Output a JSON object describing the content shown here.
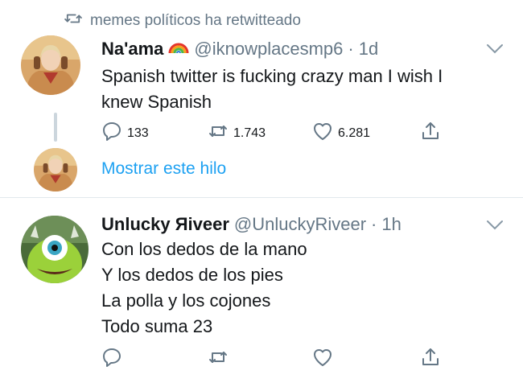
{
  "retweet_context": {
    "icon": "retweet-icon",
    "text": "memes políticos ha retwitteado"
  },
  "tweet1": {
    "name": "Na'ama",
    "emoji": "rainbow-emoji",
    "handle": "@iknowplacesmp6",
    "separator": "·",
    "time": "1d",
    "text_lines": [
      "Spanish twitter is fucking crazy man I wish I",
      "knew Spanish"
    ],
    "replies": "133",
    "retweets": "1.743",
    "likes": "6.281"
  },
  "thread": {
    "label": "Mostrar este hilo"
  },
  "tweet2": {
    "name": "Unlucky Яiveer",
    "handle": "@UnluckyRiveer",
    "separator": "·",
    "time": "1h",
    "text_lines": [
      "Con los dedos de la mano",
      "Y los dedos de los pies",
      "La polla y los cojones",
      "Todo suma 23"
    ]
  },
  "colors": {
    "text": "#14171a",
    "secondary": "#657786",
    "link": "#1da1f2",
    "divider": "#e1e8ed"
  }
}
